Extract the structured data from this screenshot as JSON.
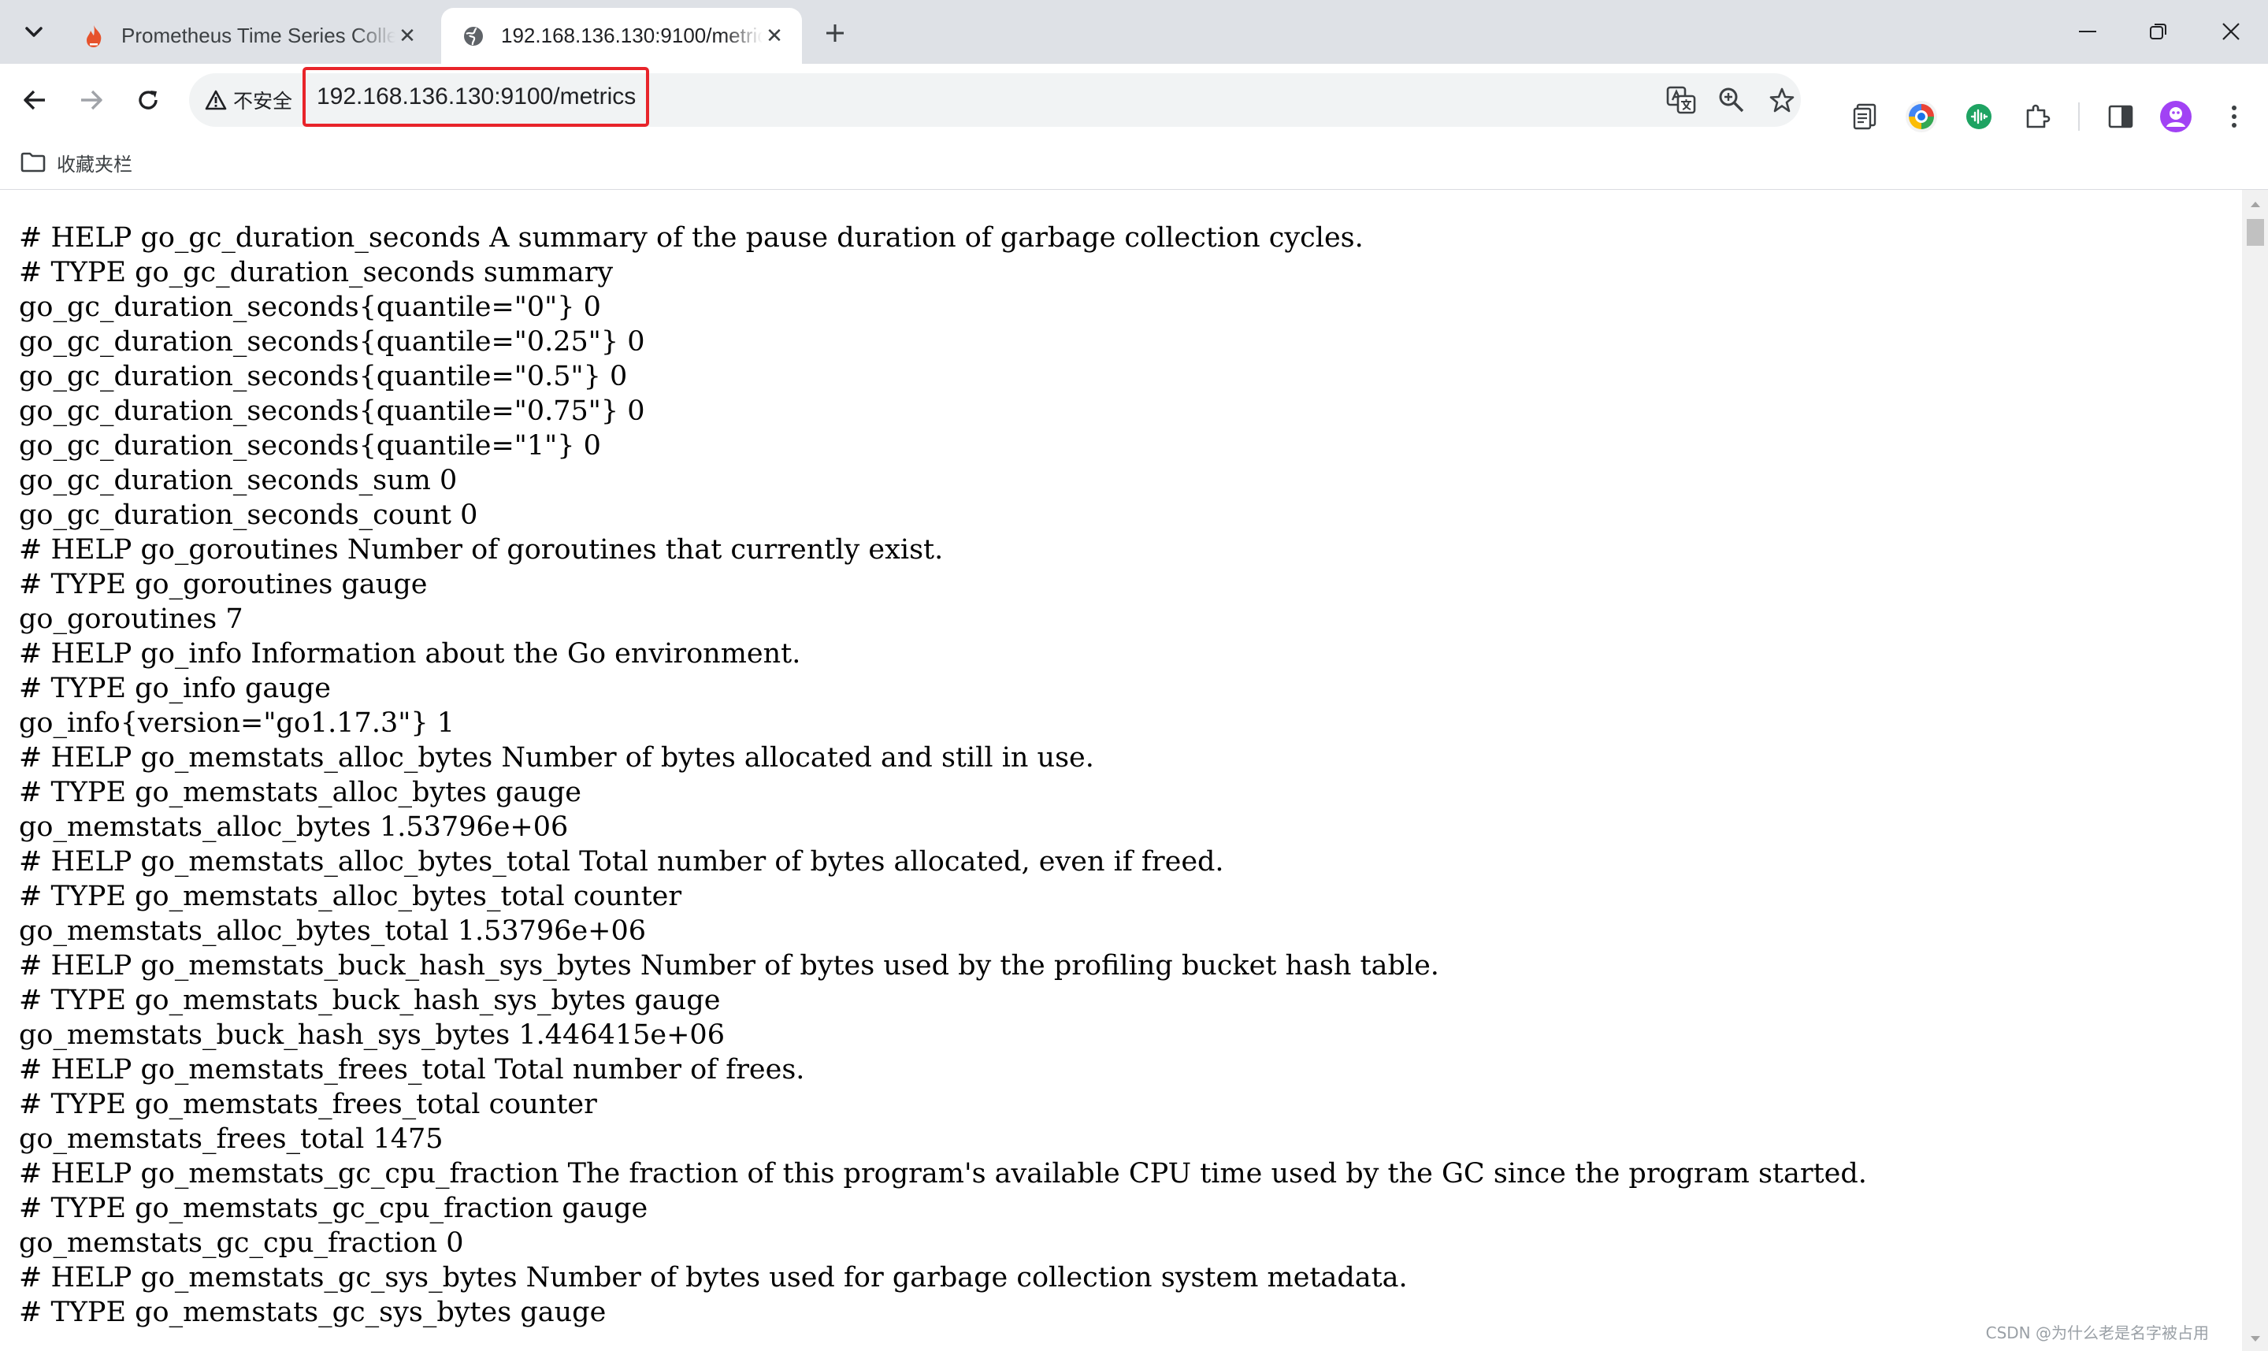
{
  "tabs": [
    {
      "title": "Prometheus Time Series Colle",
      "close": "✕"
    },
    {
      "title": "192.168.136.130:9100/metrics",
      "close": "✕"
    }
  ],
  "new_tab": "+",
  "toolbar": {
    "security_label": "不安全",
    "url": "192.168.136.130:9100/metrics"
  },
  "bookmarks": {
    "folder_label": "收藏夹栏"
  },
  "metrics_lines": [
    "# HELP go_gc_duration_seconds A summary of the pause duration of garbage collection cycles.",
    "# TYPE go_gc_duration_seconds summary",
    "go_gc_duration_seconds{quantile=\"0\"} 0",
    "go_gc_duration_seconds{quantile=\"0.25\"} 0",
    "go_gc_duration_seconds{quantile=\"0.5\"} 0",
    "go_gc_duration_seconds{quantile=\"0.75\"} 0",
    "go_gc_duration_seconds{quantile=\"1\"} 0",
    "go_gc_duration_seconds_sum 0",
    "go_gc_duration_seconds_count 0",
    "# HELP go_goroutines Number of goroutines that currently exist.",
    "# TYPE go_goroutines gauge",
    "go_goroutines 7",
    "# HELP go_info Information about the Go environment.",
    "# TYPE go_info gauge",
    "go_info{version=\"go1.17.3\"} 1",
    "# HELP go_memstats_alloc_bytes Number of bytes allocated and still in use.",
    "# TYPE go_memstats_alloc_bytes gauge",
    "go_memstats_alloc_bytes 1.53796e+06",
    "# HELP go_memstats_alloc_bytes_total Total number of bytes allocated, even if freed.",
    "# TYPE go_memstats_alloc_bytes_total counter",
    "go_memstats_alloc_bytes_total 1.53796e+06",
    "# HELP go_memstats_buck_hash_sys_bytes Number of bytes used by the profiling bucket hash table.",
    "# TYPE go_memstats_buck_hash_sys_bytes gauge",
    "go_memstats_buck_hash_sys_bytes 1.446415e+06",
    "# HELP go_memstats_frees_total Total number of frees.",
    "# TYPE go_memstats_frees_total counter",
    "go_memstats_frees_total 1475",
    "# HELP go_memstats_gc_cpu_fraction The fraction of this program's available CPU time used by the GC since the program started.",
    "# TYPE go_memstats_gc_cpu_fraction gauge",
    "go_memstats_gc_cpu_fraction 0",
    "# HELP go_memstats_gc_sys_bytes Number of bytes used for garbage collection system metadata.",
    "# TYPE go_memstats_gc_sys_bytes gauge"
  ],
  "watermark": "CSDN @为什么老是名字被占用",
  "icons": {
    "tab_search": "chevron-down-icon",
    "prometheus_tab": "flame-icon",
    "active_tab": "globe-icon",
    "back": "arrow-left-icon",
    "forward": "arrow-right-icon",
    "reload": "reload-icon",
    "translate": "translate-icon",
    "zoom": "zoom-icon",
    "bookmark": "star-icon"
  },
  "colors": {
    "url_highlight": "#e8242a",
    "tabstrip": "#dee1e6",
    "omnibox": "#f1f3f4"
  }
}
